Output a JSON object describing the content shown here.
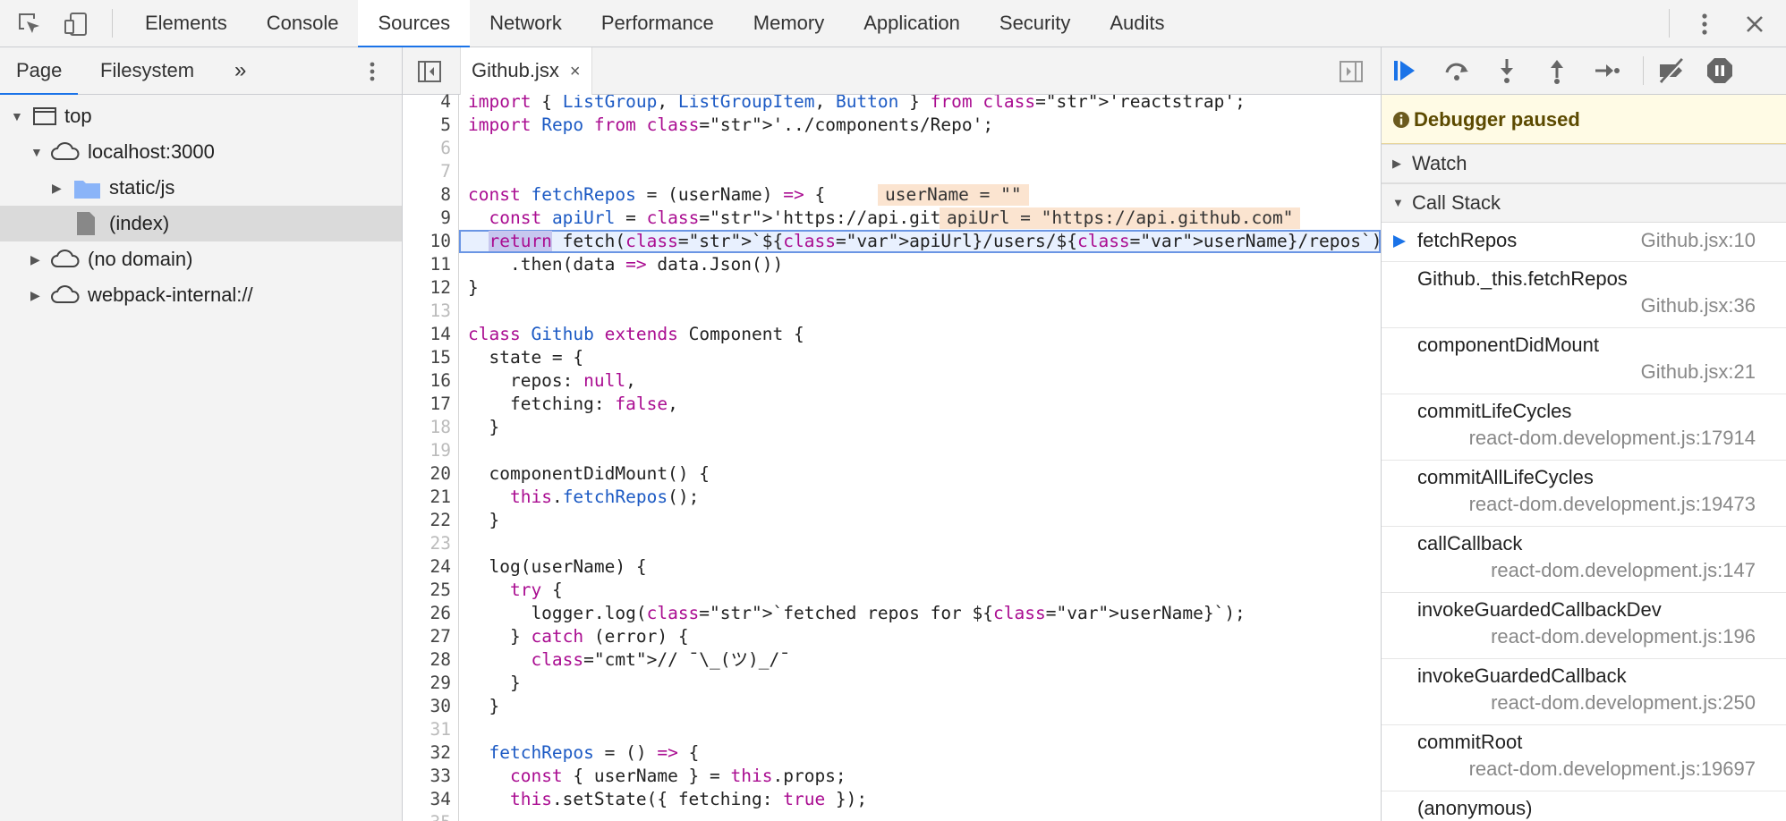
{
  "toolbar": {
    "tabs": [
      "Elements",
      "Console",
      "Sources",
      "Network",
      "Performance",
      "Memory",
      "Application",
      "Security",
      "Audits"
    ],
    "active_tab": "Sources"
  },
  "navigator": {
    "tabs": [
      "Page",
      "Filesystem"
    ],
    "more": "»",
    "tree": [
      {
        "label": "top",
        "icon": "frame-icon",
        "expanded": true
      },
      {
        "label": "localhost:3000",
        "icon": "cloud-icon",
        "expanded": true
      },
      {
        "label": "static/js",
        "icon": "folder-icon",
        "expanded": false
      },
      {
        "label": "(index)",
        "icon": "file-icon",
        "selected": true
      },
      {
        "label": "(no domain)",
        "icon": "cloud-icon",
        "expanded": false
      },
      {
        "label": "webpack-internal://",
        "icon": "cloud-icon",
        "expanded": false
      }
    ]
  },
  "editor": {
    "file_tab": "Github.jsx",
    "close_glyph": "×",
    "current_line": 10,
    "inline_values": {
      "line8": "userName = \"\"",
      "line9": "apiUrl = \"https://api.github.com\""
    },
    "lines": [
      {
        "n": "4",
        "text": "import { ListGroup, ListGroupItem, Button } from 'reactstrap';"
      },
      {
        "n": "5",
        "text": "import Repo from '../components/Repo';"
      },
      {
        "n": "6",
        "text": ""
      },
      {
        "n": "7",
        "text": ""
      },
      {
        "n": "8",
        "text": "const fetchRepos = (userName) => {"
      },
      {
        "n": "9",
        "text": "  const apiUrl = 'https://api.github.com'"
      },
      {
        "n": "10",
        "text": "  return fetch(`${apiUrl}/users/${userName}/repos`)"
      },
      {
        "n": "11",
        "text": "    .then(data => data.Json())"
      },
      {
        "n": "12",
        "text": "}"
      },
      {
        "n": "13",
        "text": ""
      },
      {
        "n": "14",
        "text": "class Github extends Component {"
      },
      {
        "n": "15",
        "text": "  state = {"
      },
      {
        "n": "16",
        "text": "    repos: null,"
      },
      {
        "n": "17",
        "text": "    fetching: false,"
      },
      {
        "n": "18",
        "text": "  }"
      },
      {
        "n": "19",
        "text": ""
      },
      {
        "n": "20",
        "text": "  componentDidMount() {"
      },
      {
        "n": "21",
        "text": "    this.fetchRepos();"
      },
      {
        "n": "22",
        "text": "  }"
      },
      {
        "n": "23",
        "text": ""
      },
      {
        "n": "24",
        "text": "  log(userName) {"
      },
      {
        "n": "25",
        "text": "    try {"
      },
      {
        "n": "26",
        "text": "      logger.log(`fetched repos for ${userName}`);"
      },
      {
        "n": "27",
        "text": "    } catch (error) {"
      },
      {
        "n": "28",
        "text": "      // ¯\\_(ツ)_/¯"
      },
      {
        "n": "29",
        "text": "    }"
      },
      {
        "n": "30",
        "text": "  }"
      },
      {
        "n": "31",
        "text": ""
      },
      {
        "n": "32",
        "text": "  fetchRepos = () => {"
      },
      {
        "n": "33",
        "text": "    const { userName } = this.props;"
      },
      {
        "n": "34",
        "text": "    this.setState({ fetching: true });"
      },
      {
        "n": "35",
        "text": ""
      }
    ]
  },
  "debugger": {
    "paused_text": "Debugger paused",
    "watch_label": "Watch",
    "callstack_label": "Call Stack",
    "frames": [
      {
        "name": "fetchRepos",
        "loc": "Github.jsx:10",
        "active": true
      },
      {
        "name": "Github._this.fetchRepos",
        "loc": "Github.jsx:36"
      },
      {
        "name": "componentDidMount",
        "loc": "Github.jsx:21"
      },
      {
        "name": "commitLifeCycles",
        "loc": "react-dom.development.js:17914"
      },
      {
        "name": "commitAllLifeCycles",
        "loc": "react-dom.development.js:19473"
      },
      {
        "name": "callCallback",
        "loc": "react-dom.development.js:147"
      },
      {
        "name": "invokeGuardedCallbackDev",
        "loc": "react-dom.development.js:196"
      },
      {
        "name": "invokeGuardedCallback",
        "loc": "react-dom.development.js:250"
      },
      {
        "name": "commitRoot",
        "loc": "react-dom.development.js:19697"
      },
      {
        "name": "(anonymous)",
        "loc": ""
      }
    ]
  },
  "colors": {
    "accent": "#1a73e8",
    "paused_bg": "#fffbe5",
    "inline_value_bg": "#fbe4d0",
    "current_line_bg": "#e8f0fe"
  }
}
